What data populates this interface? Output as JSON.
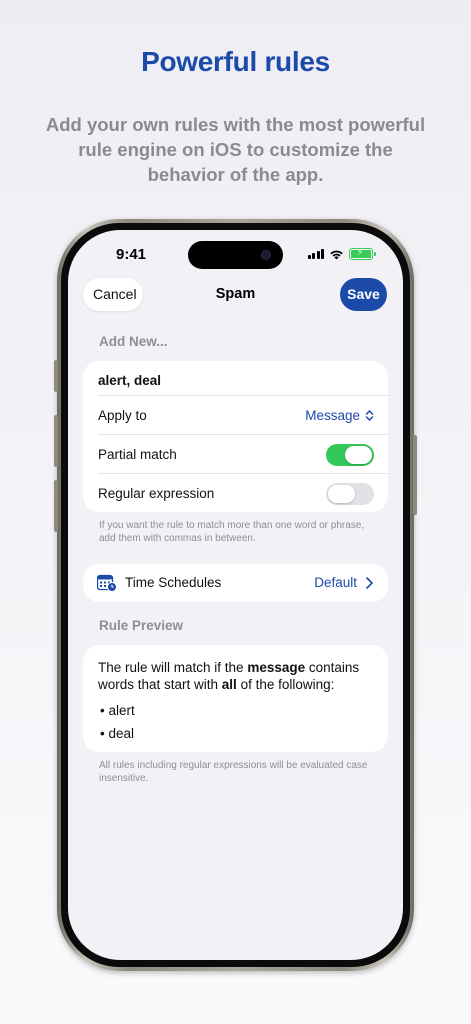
{
  "marketing": {
    "headline": "Powerful rules",
    "subhead": "Add your own rules with the most powerful rule engine on iOS to customize the behavior of the app."
  },
  "status_bar": {
    "time": "9:41"
  },
  "nav": {
    "cancel_label": "Cancel",
    "title": "Spam",
    "save_label": "Save"
  },
  "rule_form": {
    "section_label": "Add New...",
    "keywords_value": "alert, deal",
    "apply_to": {
      "label": "Apply to",
      "value": "Message"
    },
    "partial_match": {
      "label": "Partial match",
      "enabled": true
    },
    "regular_expression": {
      "label": "Regular expression",
      "enabled": false
    },
    "footnote": "If you want the rule to match more than one word or phrase, add them with commas in between."
  },
  "time_schedules": {
    "label": "Time Schedules",
    "value": "Default"
  },
  "rule_preview": {
    "section_label": "Rule Preview",
    "text_1": "The rule will match if the ",
    "text_bold_1": "message",
    "text_2": " contains words that start with ",
    "text_bold_2": "all",
    "text_3": " of the following:",
    "items": [
      "alert",
      "deal"
    ],
    "footnote": "All rules including regular expressions will be evaluated case insensitive."
  },
  "colors": {
    "accent": "#1b4aa8",
    "toggle_on": "#34c759",
    "battery": "#3acb5a"
  }
}
